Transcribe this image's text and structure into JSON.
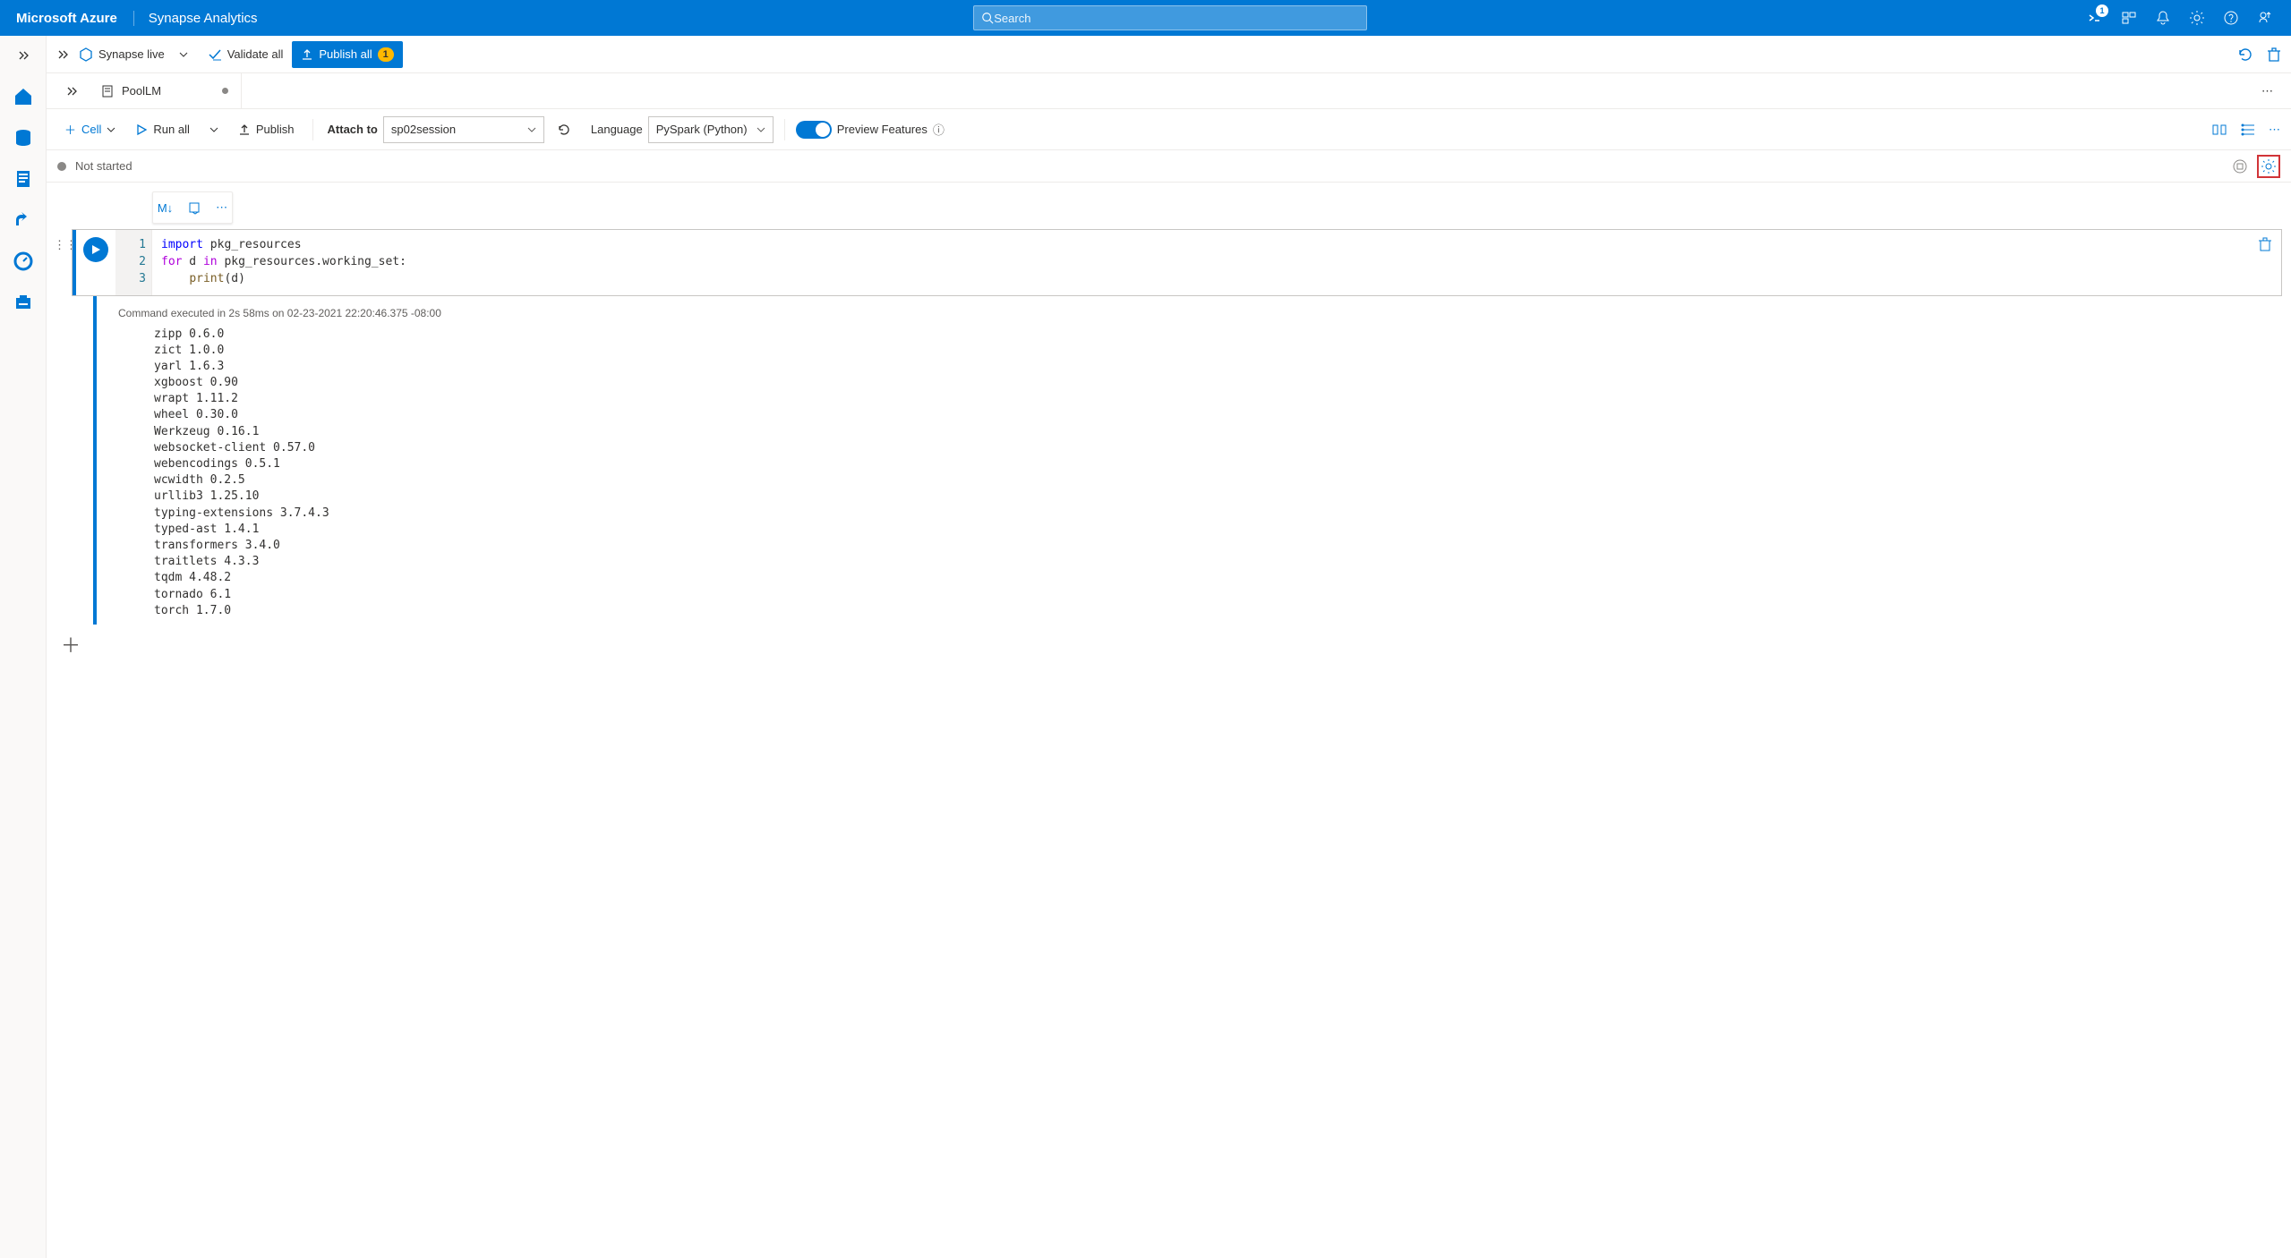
{
  "header": {
    "brand": "Microsoft Azure",
    "service": "Synapse Analytics",
    "search_placeholder": "Search",
    "notifications_badge": "1"
  },
  "sub1": {
    "live_label": "Synapse live",
    "validate_label": "Validate all",
    "publish_label": "Publish all",
    "publish_count": "1"
  },
  "tab": {
    "name": "PoolLM"
  },
  "toolbar": {
    "cell_label": "Cell",
    "runall_label": "Run all",
    "publish_label": "Publish",
    "attach_label": "Attach to",
    "attach_value": "sp02session",
    "language_label": "Language",
    "language_value": "PySpark (Python)",
    "preview_label": "Preview Features"
  },
  "status": {
    "text": "Not started"
  },
  "cell_toolbar": {
    "md": "M↓"
  },
  "code": {
    "gutter": "1\n2\n3",
    "line1_kw": "import",
    "line1_rest": " pkg_resources",
    "line2_for": "for",
    "line2_mid": " d ",
    "line2_in": "in",
    "line2_rest": " pkg_resources.working_set:",
    "line3_indent": "    ",
    "line3_fn": "print",
    "line3_args": "(d)"
  },
  "output": {
    "meta": "Command executed in 2s 58ms on 02-23-2021 22:20:46.375 -08:00",
    "lines": "zipp 0.6.0\nzict 1.0.0\nyarl 1.6.3\nxgboost 0.90\nwrapt 1.11.2\nwheel 0.30.0\nWerkzeug 0.16.1\nwebsocket-client 0.57.0\nwebencodings 0.5.1\nwcwidth 0.2.5\nurllib3 1.25.10\ntyping-extensions 3.7.4.3\ntyped-ast 1.4.1\ntransformers 3.4.0\ntraitlets 4.3.3\ntqdm 4.48.2\ntornado 6.1\ntorch 1.7.0"
  }
}
